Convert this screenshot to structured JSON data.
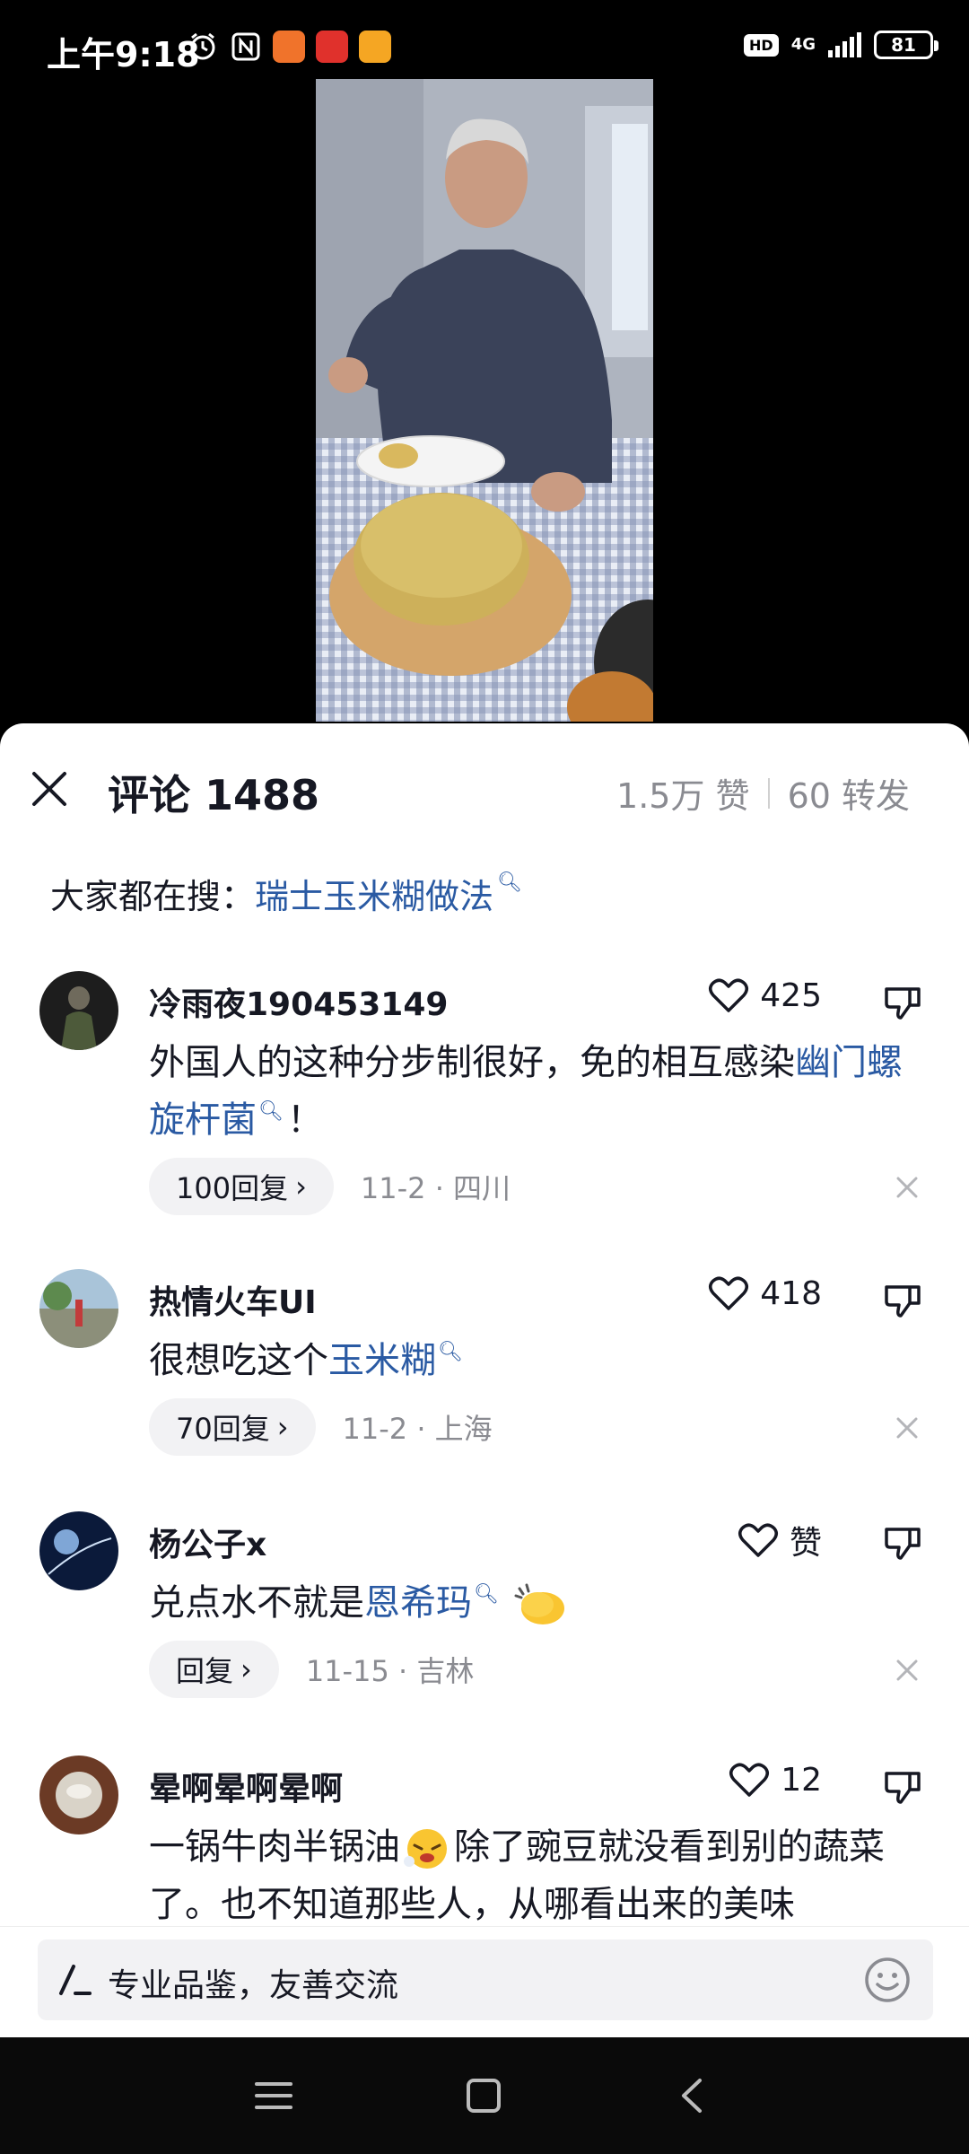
{
  "status_bar": {
    "time": "上午9:18",
    "network": "4G",
    "hd": "HD",
    "battery": "81",
    "notif_icons": [
      "alarm-icon",
      "nfc-icon",
      "app-icon-orange",
      "app-icon-red",
      "app-icon-yellow"
    ]
  },
  "panel": {
    "title": "评论 1488",
    "likes": "1.5万 赞",
    "shares": "60 转发",
    "search_prefix": "大家都在搜：",
    "search_term": "瑞士玉米糊做法"
  },
  "comments": [
    {
      "username": "冷雨夜190453149",
      "likes": "425",
      "text_before": "外国人的这种分步制很好，免的相互感染",
      "link": "幽门螺旋杆菌",
      "text_after": "！",
      "reply": "100回复",
      "meta": "11-2 · 四川"
    },
    {
      "username": "热情火车UI",
      "likes": "418",
      "text_before": "很想吃这个",
      "link": "玉米糊",
      "text_after": "",
      "reply": "70回复",
      "meta": "11-2 · 上海"
    },
    {
      "username": "杨公子x",
      "likes": "赞",
      "text_before": "兑点水不就是",
      "link": "恩希玛",
      "text_after": "",
      "reply": "回复",
      "meta": "11-15 · 吉林"
    },
    {
      "username": "晕啊晕啊晕啊",
      "likes": "12",
      "text_before": "一锅牛肉半锅油",
      "text_after": "除了豌豆就没看到别的蔬菜了。也不知道那些人，从哪看出来的美味"
    }
  ],
  "input": {
    "placeholder": "专业品鉴，友善交流"
  },
  "colors": {
    "link": "#2a5aa3",
    "muted": "#8a8b91",
    "text": "#161823"
  }
}
